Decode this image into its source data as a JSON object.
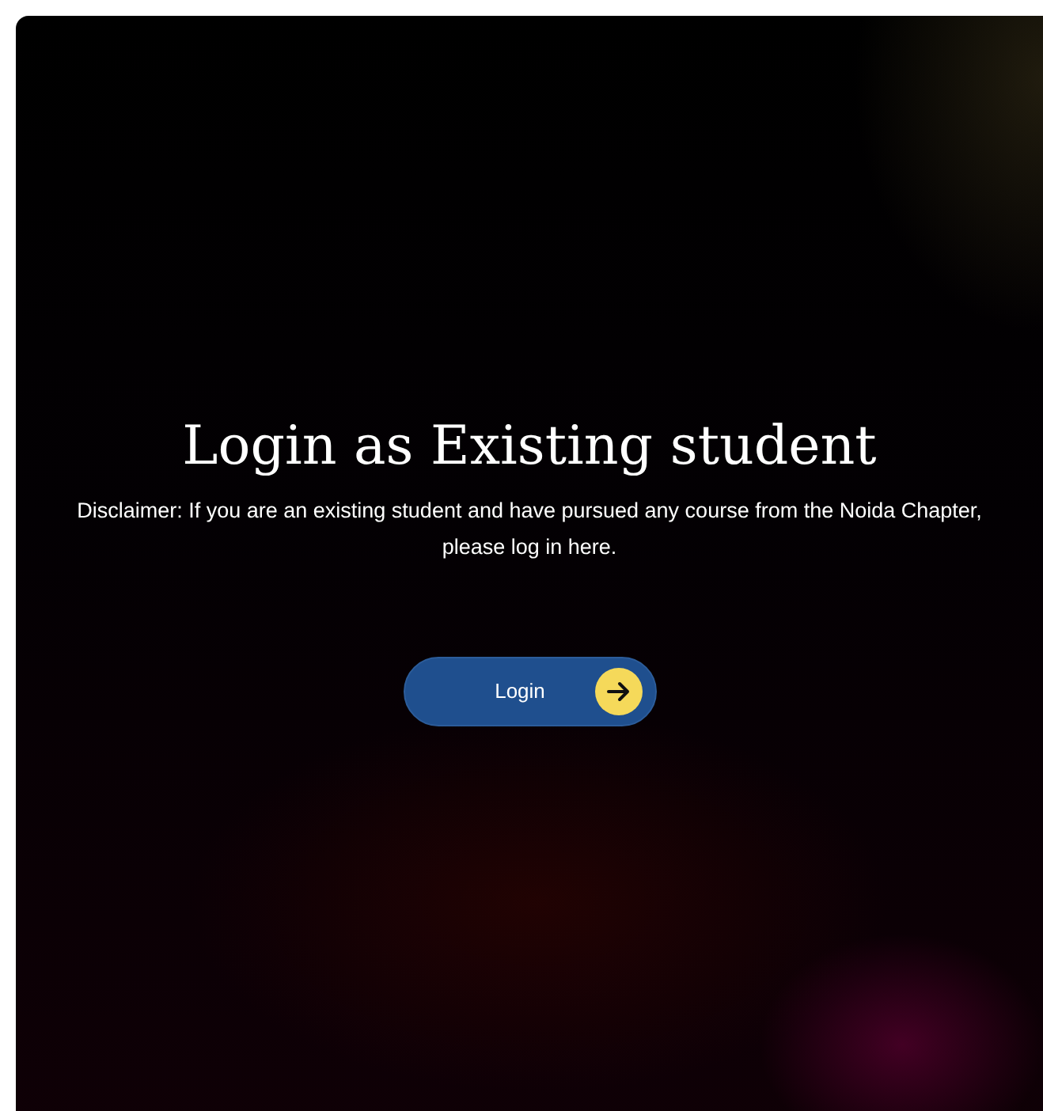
{
  "title": "Login as Existing student",
  "disclaimer": "Disclaimer: If you are an existing student and have pursued any course from the Noida Chapter, please log in here.",
  "button": {
    "label": "Login"
  }
}
